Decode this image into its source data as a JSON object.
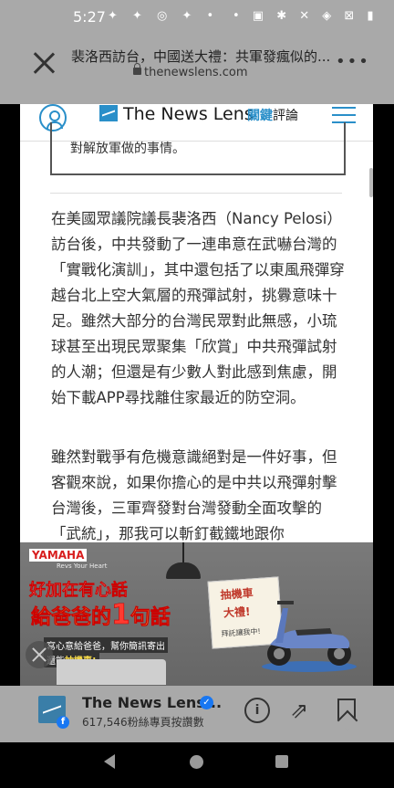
{
  "status_bar": {
    "time": "5:27",
    "left_icons": "✦ ✦ ◎ ✦ •",
    "right_icons": "• ▣ ✱ ✕ ◈ ⊠ ▮"
  },
  "custom_tab": {
    "title": "裴洛西訪台，中國送大禮：共軍發瘋似的...",
    "url": "thenewslens.com"
  },
  "site": {
    "logo_en": "The News Lens",
    "logo_cn_bold": "關鍵",
    "logo_cn_rest": "評論"
  },
  "article": {
    "quote_tail": "對解放軍做的事情。",
    "paragraph1": "在美國眾議院議長裴洛西（Nancy Pelosi）訪台後，中共發動了一連串意在武嚇台灣的「實戰化演訓」，其中還包括了以東風飛彈穿越台北上空大氣層的飛彈試射，挑釁意味十足。雖然大部分的台灣民眾對此無感，小琉球甚至出現民眾聚集「欣賞」中共飛彈試射的人潮；但還是有少數人對此感到焦慮，開始下載APP尋找離住家最近的防空洞。",
    "paragraph2": "雖然對戰爭有危機意識絕對是一件好事，但客觀來說，如果你擔心的是中共以飛彈射擊台灣後，三軍齊發對台灣發動全面攻擊的「武統」，那我可以斬釘截鐵地跟你"
  },
  "ad": {
    "brand": "YAMAHA",
    "brand_sub": "Revs Your Heart",
    "headline1": "好加在有心話",
    "headline2a": "給爸爸的",
    "headline2b": "1",
    "headline2c": "句話",
    "line1": "寫心意給爸爸，幫你簡訊寄出",
    "line2a": "還能",
    "line2b": "抽機車!",
    "note1": "抽機車",
    "note2": "大禮!",
    "note3": "拜託讓我中!"
  },
  "bottom_bar": {
    "page_name": "The News Lens...",
    "followers": "617,546粉絲專頁按讚數",
    "fb_letter": "f",
    "info_label": "i",
    "share_glyph": "⇗"
  },
  "colors": {
    "brand_blue": "#2a8fc9",
    "chrome_gray": "#a9a9a9",
    "yamaha_red": "#d81e1e"
  }
}
